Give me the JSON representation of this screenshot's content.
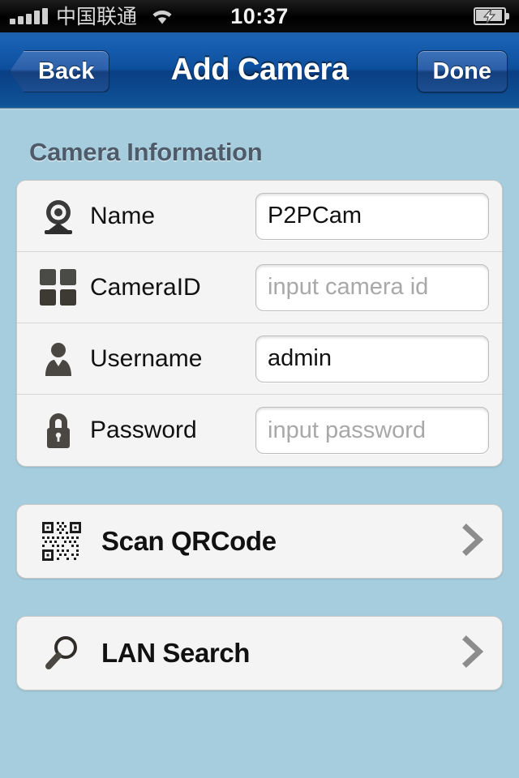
{
  "statusbar": {
    "carrier": "中国联通",
    "time": "10:37",
    "signal_icon": "signal-bars-icon",
    "wifi_icon": "wifi-icon",
    "battery_icon": "battery-charging-icon"
  },
  "navbar": {
    "back_label": "Back",
    "title": "Add Camera",
    "done_label": "Done"
  },
  "section": {
    "header": "Camera Information"
  },
  "form": {
    "rows": [
      {
        "icon": "webcam-icon",
        "label": "Name",
        "value": "P2PCam",
        "placeholder": "",
        "is_placeholder": false
      },
      {
        "icon": "grid-icon",
        "label": "CameraID",
        "value": "input camera id",
        "placeholder": "input camera id",
        "is_placeholder": true
      },
      {
        "icon": "person-icon",
        "label": "Username",
        "value": "admin",
        "placeholder": "",
        "is_placeholder": false
      },
      {
        "icon": "lock-icon",
        "label": "Password",
        "value": "input password",
        "placeholder": "input password",
        "is_placeholder": true
      }
    ]
  },
  "actions": [
    {
      "icon": "qrcode-icon",
      "label": "Scan QRCode",
      "chevron": "chevron-right-icon"
    },
    {
      "icon": "magnifier-icon",
      "label": "LAN Search",
      "chevron": "chevron-right-icon"
    }
  ],
  "colors": {
    "background": "#a6cddd",
    "navbar_blue": "#0d4f9e",
    "section_header_text": "#4d5b6b",
    "card_background": "#f4f4f4",
    "placeholder_text": "#a8a8a8",
    "chevron_gray": "#8c8c8c"
  }
}
